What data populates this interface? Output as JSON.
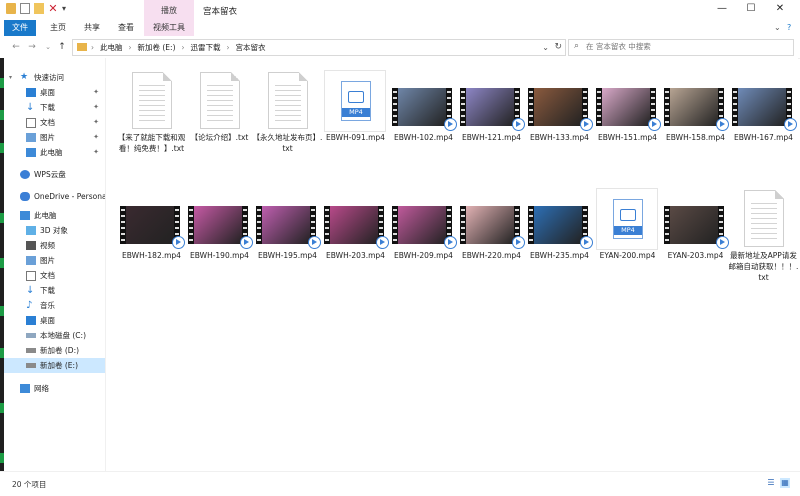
{
  "window": {
    "title": "宫本留衣",
    "context_tab_group": "播放"
  },
  "ribbon": {
    "file": "文件",
    "home": "主页",
    "share": "共享",
    "view": "查看",
    "video_tools": "视频工具"
  },
  "address": {
    "crumbs": [
      "此电脑",
      "新加卷 (E:)",
      "迅雷下载",
      "宫本留衣"
    ]
  },
  "search": {
    "placeholder": "在 宫本留衣 中搜索"
  },
  "sidebar": {
    "quick_access": "快速访问",
    "quick_items": [
      "桌面",
      "下载",
      "文档",
      "图片",
      "此电脑"
    ],
    "wps": "WPS云盘",
    "onedrive": "OneDrive - Persona",
    "this_pc": "此电脑",
    "pc_items": [
      "3D 对象",
      "视频",
      "图片",
      "文档",
      "下载",
      "音乐",
      "桌面",
      "本地磁盘 (C:)",
      "新加卷 (D:)",
      "新加卷 (E:)"
    ],
    "network": "网络"
  },
  "files": [
    {
      "name": "【来了就能下载和观看！纯免费！】.txt",
      "kind": "txt"
    },
    {
      "name": "【论坛介绍】.txt",
      "kind": "txt"
    },
    {
      "name": "【永久地址发布页】.txt",
      "kind": "txt"
    },
    {
      "name": "EBWH-091.mp4",
      "kind": "mp4"
    },
    {
      "name": "EBWH-102.mp4",
      "kind": "video",
      "color": "#6f86a8"
    },
    {
      "name": "EBWH-121.mp4",
      "kind": "video",
      "color": "#8d86c6"
    },
    {
      "name": "EBWH-133.mp4",
      "kind": "video",
      "color": "#8a5a3e"
    },
    {
      "name": "EBWH-151.mp4",
      "kind": "video",
      "color": "#d9a9c9"
    },
    {
      "name": "EBWH-158.mp4",
      "kind": "video",
      "color": "#b7a493"
    },
    {
      "name": "EBWH-167.mp4",
      "kind": "video",
      "color": "#6f8bb8"
    },
    {
      "name": "EBWH-182.mp4",
      "kind": "video",
      "color": "#3a2a30"
    },
    {
      "name": "EBWH-190.mp4",
      "kind": "video",
      "color": "#c65aa5"
    },
    {
      "name": "EBWH-195.mp4",
      "kind": "video",
      "color": "#bf5fb0"
    },
    {
      "name": "EBWH-203.mp4",
      "kind": "video",
      "color": "#b84a8a"
    },
    {
      "name": "EBWH-209.mp4",
      "kind": "video",
      "color": "#c05a9c"
    },
    {
      "name": "EBWH-220.mp4",
      "kind": "video",
      "color": "#e2b2b4"
    },
    {
      "name": "EBWH-235.mp4",
      "kind": "video",
      "color": "#2d6fb5"
    },
    {
      "name": "EYAN-200.mp4",
      "kind": "mp4"
    },
    {
      "name": "EYAN-203.mp4",
      "kind": "video",
      "color": "#5a4a45"
    },
    {
      "name": "最新地址及APP请发邮箱自动获取！！！.txt",
      "kind": "txt"
    }
  ],
  "mp4_badge": "MP4",
  "status": {
    "count": "20 个项目"
  }
}
